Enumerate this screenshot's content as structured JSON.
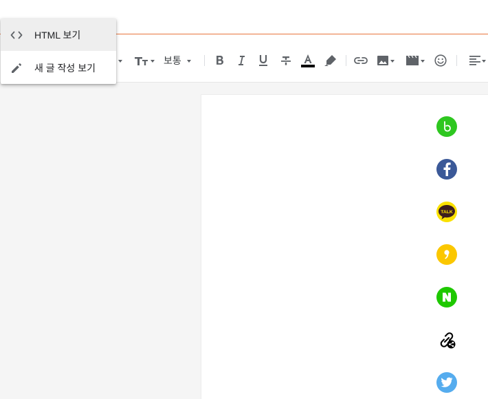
{
  "menu": {
    "items": [
      {
        "label": "HTML 보기",
        "icon": "code-icon",
        "active": true
      },
      {
        "label": "새 글 작성 보기",
        "icon": "pencil-icon",
        "active": false
      }
    ]
  },
  "toolbar": {
    "font_size_label": "보통",
    "icons": [
      "heading-icon",
      "text-size-icon",
      "bold-icon",
      "italic-icon",
      "underline-icon",
      "strikethrough-icon",
      "text-color-icon",
      "highlight-icon",
      "link-icon",
      "image-icon",
      "video-icon",
      "emoji-icon",
      "align-left-icon"
    ],
    "text_color": "#000000"
  },
  "share_icons": [
    {
      "name": "band-share-icon",
      "color": "#2ec720"
    },
    {
      "name": "facebook-share-icon",
      "color": "#3b5998"
    },
    {
      "name": "kakaotalk-share-icon",
      "color": "#fae100",
      "label": "TALK"
    },
    {
      "name": "kakaostory-share-icon",
      "color": "#fbc700"
    },
    {
      "name": "naver-share-icon",
      "color": "#1ec800"
    },
    {
      "name": "link-share-icon",
      "color": "#000000"
    },
    {
      "name": "twitter-share-icon",
      "color": "#55acee"
    }
  ],
  "colors": {
    "accent_line": "#e8743b",
    "workspace_bg": "#f5f5f5"
  }
}
